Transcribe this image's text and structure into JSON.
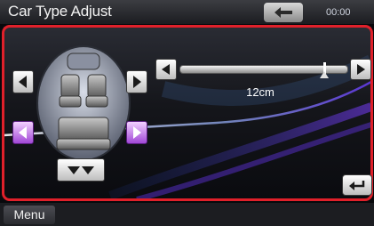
{
  "header": {
    "title": "Car Type Adjust",
    "time": "00:00"
  },
  "slider": {
    "value_text": "12cm",
    "position_fraction": 0.86
  },
  "footer": {
    "menu_label": "Menu"
  },
  "colors": {
    "selected_border": "#e0202a",
    "selected_button": "#b45ee6",
    "accent_wave": "#8b5cf6"
  },
  "icons": {
    "back": "back-arrow-icon",
    "return": "return-icon",
    "seat": "car-seat-icon"
  }
}
